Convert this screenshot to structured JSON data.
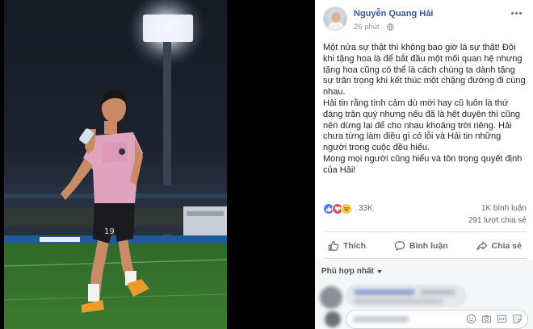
{
  "post": {
    "author": "Nguyễn Quang Hải",
    "time": "26 phút",
    "paragraphs": [
      "Một nửa sự thật thì không bao giờ là sự thật! Đôi khi tặng hoa là để bắt đầu một mối quan hệ nhưng tặng hoa cũng có thể là cách chúng ta dành tặng sự trân trọng khi kết thúc một chặng đường đi cùng nhau.",
      "Hải tin rằng tình cảm dù mới hay cũ luôn là thứ đáng trân quý nhưng nếu đã là hết duyên thì cũng nên dừng lại để cho nhau khoảng trời riêng. Hải chưa từng làm điều gì có lỗi và Hải tin những người trong cuộc đều hiểu.",
      "Mong mọi người cũng hiểu và tôn trọng quyết định của Hải!"
    ]
  },
  "stats": {
    "reactions": "33K",
    "comments": "1K bình luận",
    "shares": "291 lượt chia sẻ"
  },
  "actions": {
    "like": "Thích",
    "comment": "Bình luận",
    "share": "Chia sẻ"
  },
  "comments": {
    "sort_label": "Phù hợp nhất"
  },
  "colors": {
    "author": "#385898",
    "like": "#4a7ff1",
    "love": "#f0485a",
    "haha": "#f7c844"
  },
  "icons": [
    "globe-icon",
    "more-icon",
    "like-reaction-icon",
    "love-reaction-icon",
    "haha-reaction-icon",
    "thumbs-up-icon",
    "comment-icon",
    "share-icon",
    "emoji-icon",
    "camera-icon",
    "gif-icon",
    "sticker-icon"
  ]
}
